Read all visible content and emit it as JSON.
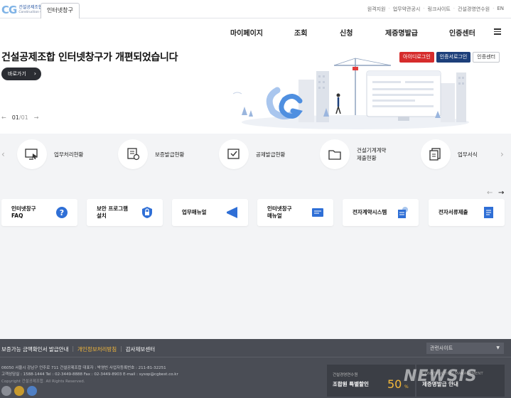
{
  "header": {
    "logo_mark": "CG",
    "logo_text_ko": "건설공제조합",
    "logo_text_en": "Construction Guarantee",
    "site_tab": "인터넷창구",
    "util_links": [
      "원격지원",
      "업무약관공시",
      "링크사이트",
      "건설경영연수원",
      "EN"
    ]
  },
  "nav": {
    "items": [
      "마이페이지",
      "조회",
      "신청",
      "제증명발급",
      "인증센터"
    ]
  },
  "hero": {
    "title": "건설공제조합 인터넷창구가 개편되었습니다",
    "go_button": "바로가기",
    "page_current": "01",
    "page_sep": "/",
    "page_total": "01",
    "login_buttons": [
      "아이디로그인",
      "인증서로그인",
      "인증센터"
    ]
  },
  "quick": {
    "items": [
      "업무처리현황",
      "보증발급현황",
      "공제발급현황",
      "건설기계계약\n제출현황",
      "업무서식"
    ]
  },
  "cards": {
    "items": [
      "인터넷창구\nFAQ",
      "보안 프로그램\n설치",
      "업무매뉴얼",
      "인터넷창구\n매뉴얼",
      "전자계약시스템",
      "전자서류제출"
    ]
  },
  "footer": {
    "links": [
      "보증가능 금액확인서 발급안내",
      "개인정보처리방침",
      "감사제보센터"
    ],
    "related_site": "관련사이트",
    "address": "06050 서울시 강남구 언주로 711 건설공제조합   대표자 : 박영빈   사업자등록번호 : 211-81-32251",
    "contact": "고객상담실 : 1588-1444   Tel : 02-3449-8888   Fax : 02-3449-8903   E-mail : sysop@cgbest.co.kr",
    "copyright": "Copyright 건설공제조합. All Rights Reserved.",
    "promo_sub": "건설경영연수원",
    "promo_title": "조합원 특별할인",
    "promo_num": "50",
    "promo_pct": "%",
    "promo2_sub": "CONSTRUCTION MANAGEMENT",
    "promo2_title": "제증명발급 안내",
    "watermark": "NEWSIS"
  },
  "colors": {
    "accent_red": "#d62c2c",
    "accent_navy": "#1d3f7a",
    "footer_bg": "#4a4d55",
    "highlight": "#f5b93a"
  }
}
